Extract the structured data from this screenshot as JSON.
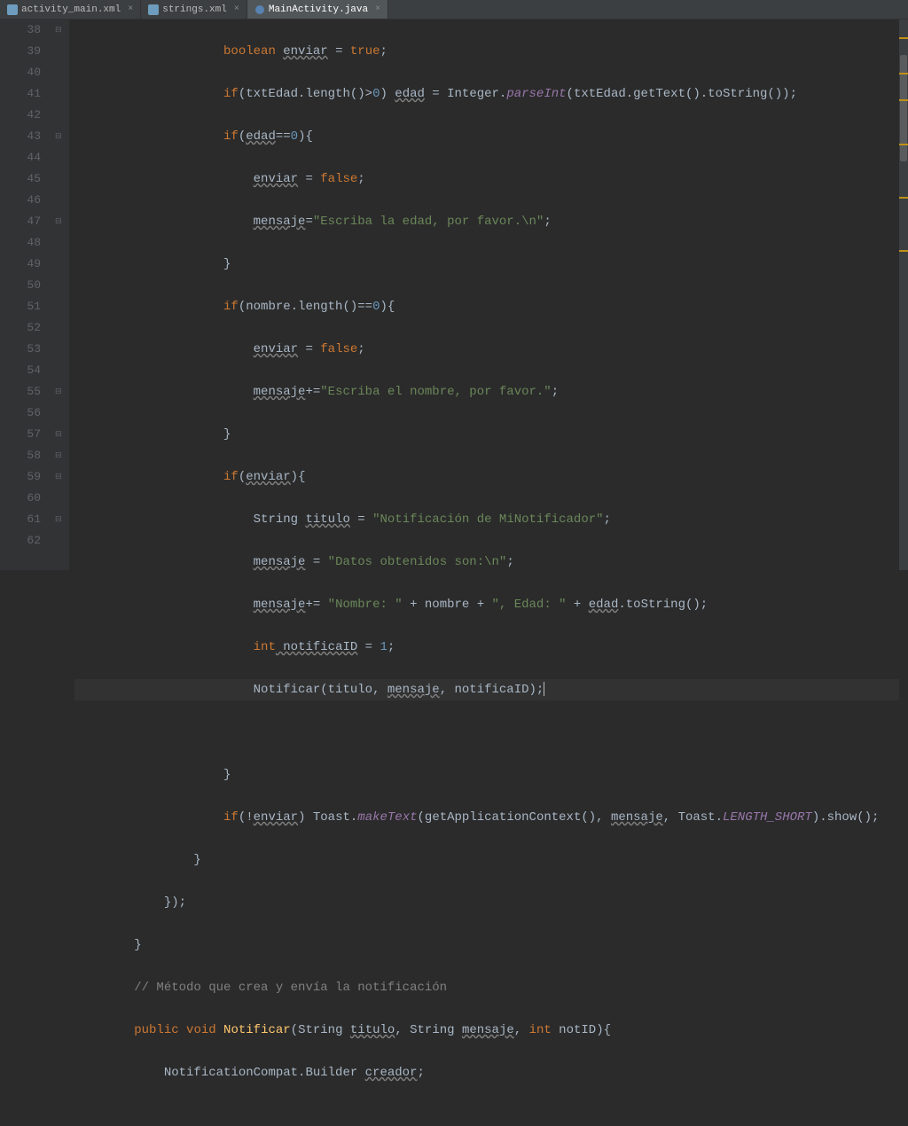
{
  "tabs": [
    {
      "label": "activity_main.xml",
      "active": false,
      "type": "xml"
    },
    {
      "label": "strings.xml",
      "active": false,
      "type": "xml"
    },
    {
      "label": "MainActivity.java",
      "active": true,
      "type": "java"
    }
  ],
  "lines": {
    "start": 38,
    "end": 62
  },
  "code": {
    "l38": {
      "indent": "                    ",
      "kw1": "boolean",
      "var": "enviar",
      "eq": " = ",
      "kw2": "true",
      "semi": ";"
    },
    "l39": {
      "indent": "                    ",
      "kw": "if",
      "open": "(txtEdad.length()>",
      "num": "0",
      "close": ") ",
      "var": "edad",
      "eq": " = Integer.",
      "fn": "parseInt",
      "args": "(txtEdad.getText().toString());"
    },
    "l40": {
      "indent": "                    ",
      "kw": "if",
      "open": "(",
      "var": "edad",
      "eq": "==",
      "num": "0",
      "close": "){"
    },
    "l41": {
      "indent": "                        ",
      "var": "enviar",
      "eq": " = ",
      "kw": "false",
      "semi": ";"
    },
    "l42": {
      "indent": "                        ",
      "var": "mensaje",
      "eq": "=",
      "str": "\"Escriba la edad, por favor.\\n\"",
      "semi": ";"
    },
    "l43": {
      "indent": "                    ",
      "brace": "}"
    },
    "l44": {
      "indent": "                    ",
      "kw": "if",
      "cond": "(nombre.length()==",
      "num": "0",
      "close": "){"
    },
    "l45": {
      "indent": "                        ",
      "var": "enviar",
      "eq": " = ",
      "kw": "false",
      "semi": ";"
    },
    "l46": {
      "indent": "                        ",
      "var": "mensaje",
      "eq": "+=",
      "str": "\"Escriba el nombre, por favor.\"",
      "semi": ";"
    },
    "l47": {
      "indent": "                    ",
      "brace": "}"
    },
    "l48": {
      "indent": "                    ",
      "kw": "if",
      "open": "(",
      "var": "enviar",
      "close": "){"
    },
    "l49": {
      "indent": "                        ",
      "type": "String ",
      "var": "titulo",
      "eq": " = ",
      "str": "\"Notificación de MiNotificador\"",
      "semi": ";"
    },
    "l50": {
      "indent": "                        ",
      "var": "mensaje",
      "eq": " = ",
      "str": "\"Datos obtenidos son:\\n\"",
      "semi": ";"
    },
    "l51": {
      "indent": "                        ",
      "var": "mensaje",
      "eq": "+= ",
      "str1": "\"Nombre: \"",
      "plus1": " + nombre + ",
      "str2": "\", Edad: \"",
      "plus2": " + ",
      "var2": "edad",
      "call": ".toString();"
    },
    "l52": {
      "indent": "                        ",
      "kw": "int",
      "var": " notificaID",
      "eq": " = ",
      "num": "1",
      "semi": ";"
    },
    "l53": {
      "indent": "                        ",
      "call": "Notificar(titulo, ",
      "var": "mensaje",
      "rest": ", notificaID);"
    },
    "l55": {
      "indent": "                    ",
      "brace": "}"
    },
    "l56": {
      "indent": "                    ",
      "kw": "if",
      "open": "(!",
      "var": "enviar",
      "close": ") Toast.",
      "fn": "makeText",
      "args1": "(getApplicationContext(), ",
      "var2": "mensaje",
      "args2": ", Toast.",
      "const": "LENGTH_SHORT",
      "args3": ").show();"
    },
    "l57": {
      "indent": "                ",
      "brace": "}"
    },
    "l58": {
      "indent": "            ",
      "brace": "});"
    },
    "l59": {
      "indent": "        ",
      "brace": "}"
    },
    "l60": {
      "indent": "        ",
      "cmt": "// Método que crea y envía la notificación"
    },
    "l61": {
      "indent": "        ",
      "kw1": "public",
      "kw2": " void",
      "fn": " Notificar",
      "args": "(String ",
      "p1": "titulo",
      "c1": ", String ",
      "p2": "mensaje",
      "c2": ", ",
      "kw3": "int",
      "p3": " notID){"
    },
    "l62": {
      "indent": "            ",
      "txt": "NotificationCompat.Builder ",
      "var": "creador",
      "semi": ";"
    }
  }
}
